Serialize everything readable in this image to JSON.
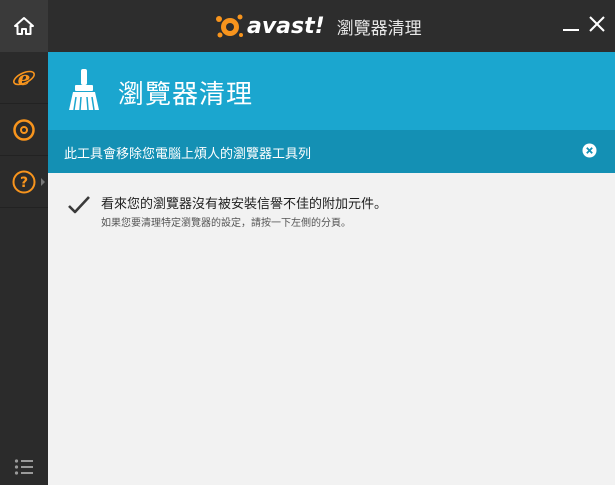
{
  "window": {
    "brand_name": "avast!",
    "title": "瀏覽器清理"
  },
  "sidebar": {
    "items": [
      {
        "name": "internet-explorer",
        "icon": "ie-icon",
        "selected": false
      },
      {
        "name": "chrome",
        "icon": "chrome-icon",
        "selected": false
      },
      {
        "name": "help",
        "icon": "help-icon",
        "selected": false
      }
    ]
  },
  "header": {
    "title": "瀏覽器清理",
    "icon": "broom-icon"
  },
  "info_bar": {
    "text": "此工具會移除您電腦上煩人的瀏覽器工具列"
  },
  "content": {
    "message_main": "看來您的瀏覽器沒有被安裝信譽不佳的附加元件。",
    "message_sub": "如果您要清理特定瀏覽器的設定，請按一下左側的分頁。"
  },
  "colors": {
    "accent": "#1ba6cf",
    "accent_dark": "#1490b4",
    "brand_orange": "#f7941d",
    "titlebar": "#2d2d2d",
    "sidebar": "#2b2b2b",
    "content_bg": "#f2f2f2"
  }
}
